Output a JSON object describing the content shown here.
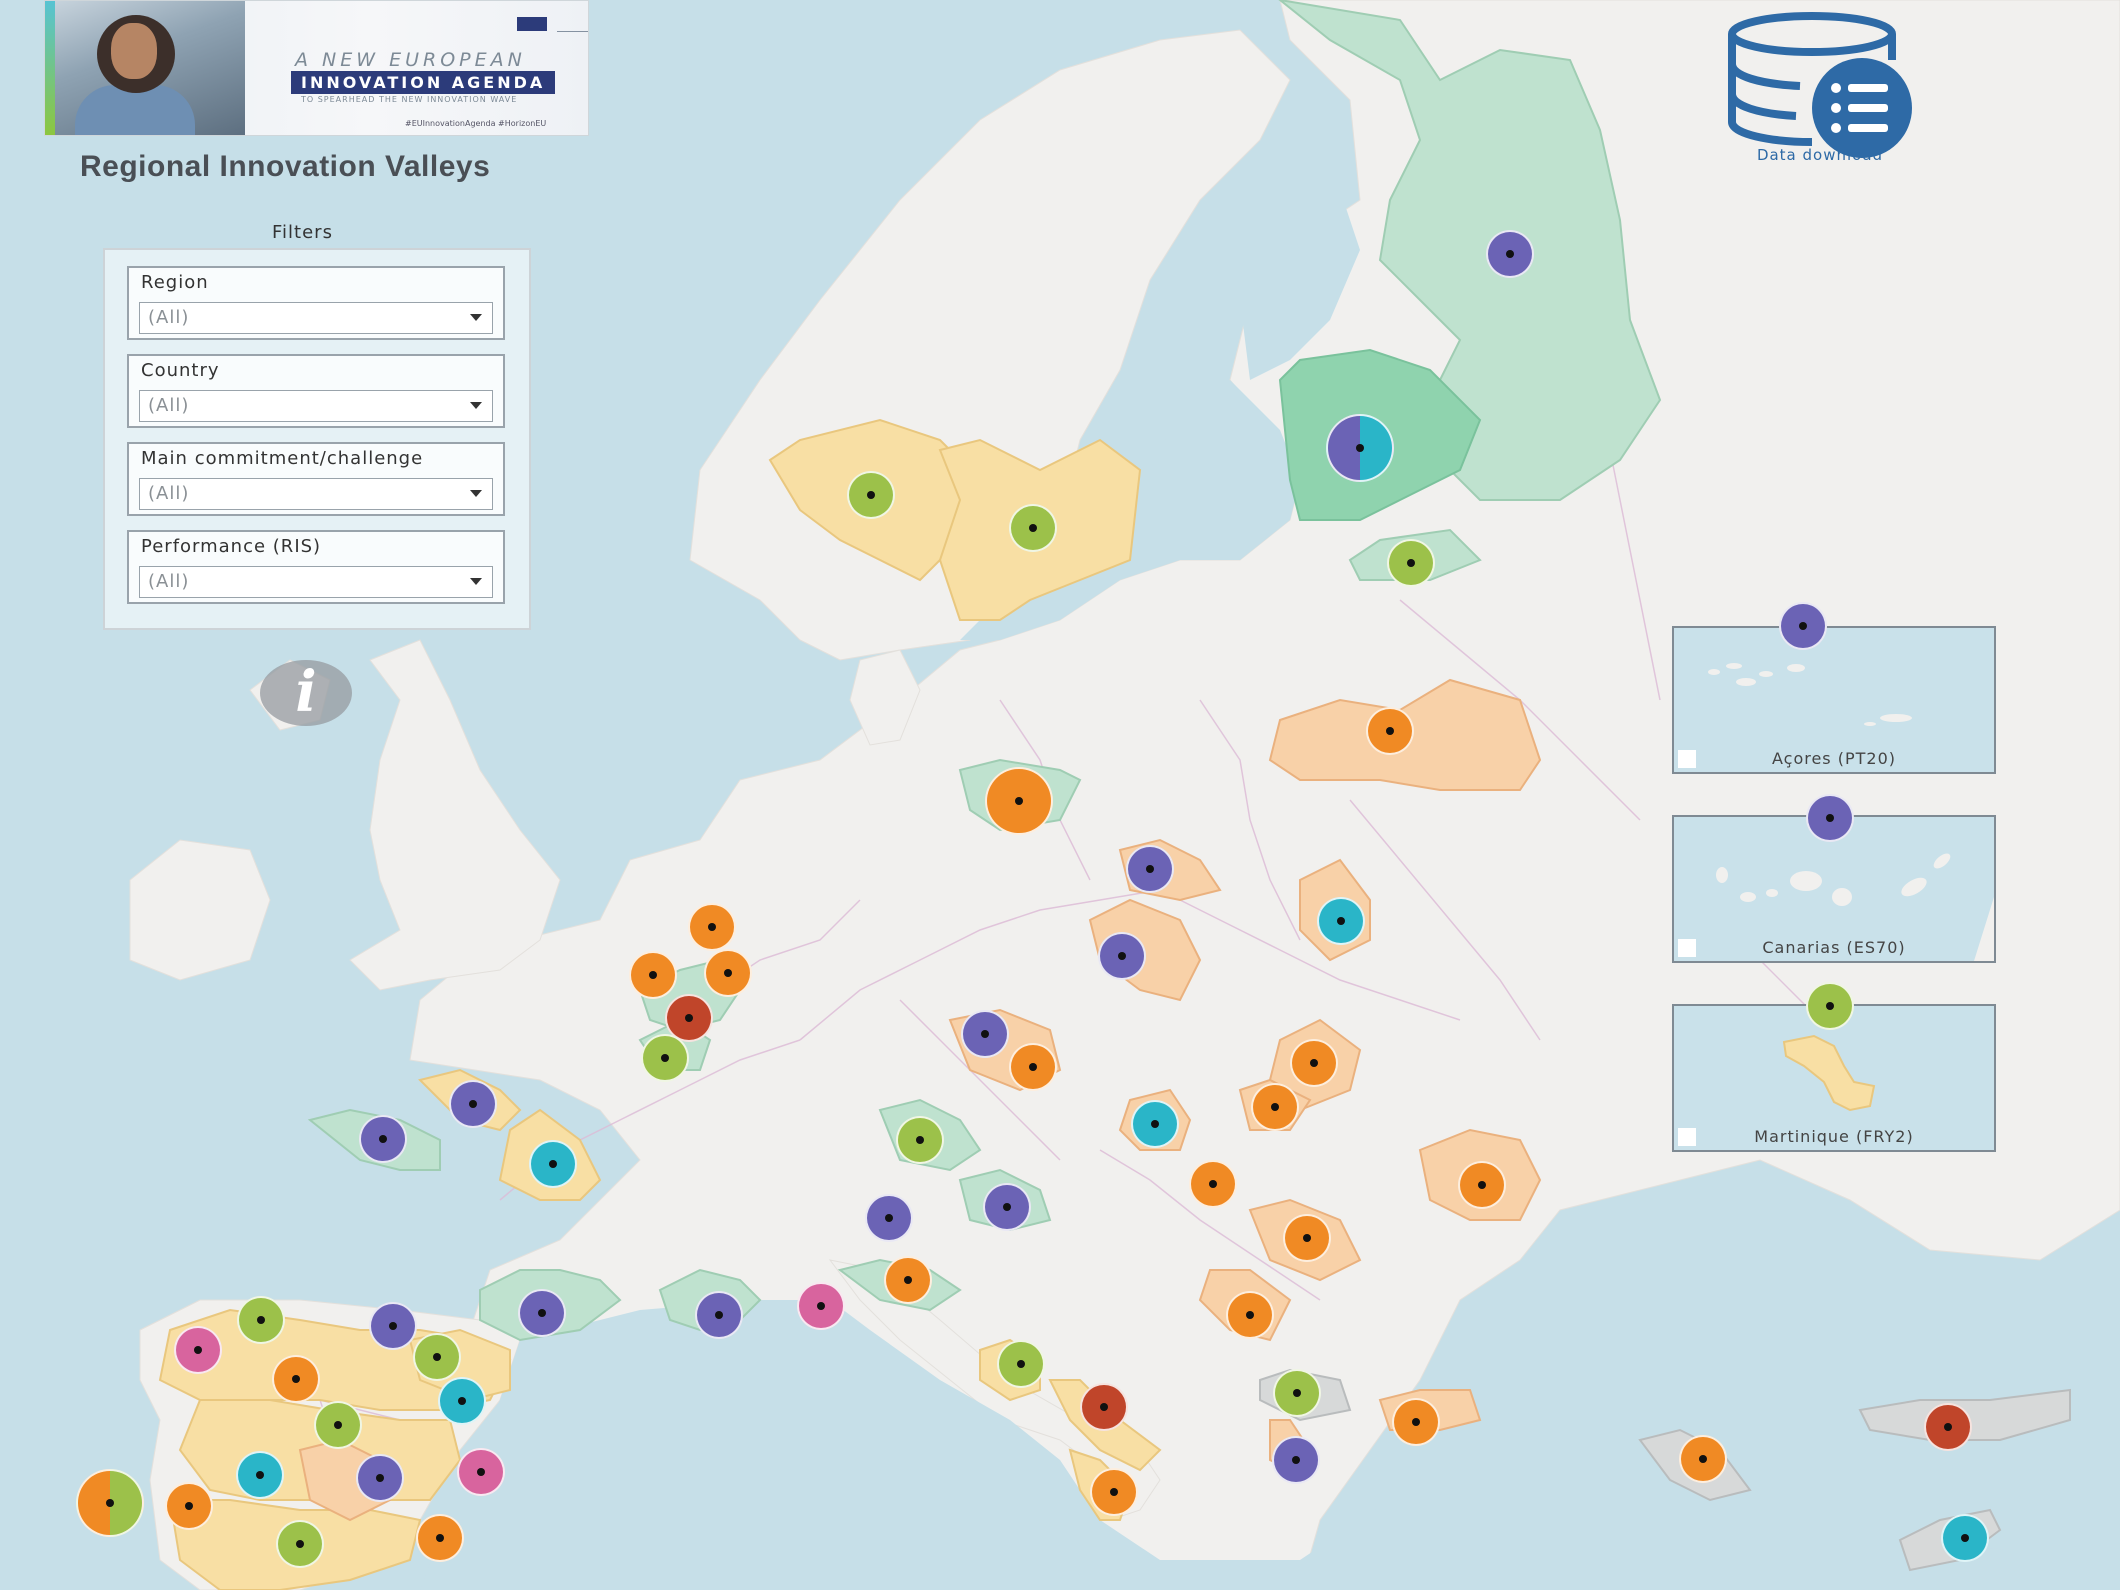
{
  "banner": {
    "line1": "A NEW EUROPEAN",
    "line2": "INNOVATION AGENDA",
    "line3": "TO SPEARHEAD THE NEW INNOVATION WAVE",
    "hashtags": "#EUInnovationAgenda   #HorizonEU"
  },
  "app_title": "Regional Innovation Valleys",
  "filters": {
    "title": "Filters",
    "items": [
      {
        "label": "Region",
        "value": "(All)"
      },
      {
        "label": "Country",
        "value": "(All)"
      },
      {
        "label": "Main commitment/challenge",
        "value": "(All)"
      },
      {
        "label": "Performance (RIS)",
        "value": "(All)"
      }
    ]
  },
  "info_icon": "info-icon",
  "data_download": {
    "label": "Data download",
    "icon": "database-list-icon"
  },
  "colors": {
    "sea": "#c6dfe8",
    "land": "#f1f0ee",
    "border_line": "#d9b8d4",
    "green_region": "#bfe2cf",
    "yellow_region": "#f8dfa4",
    "orange_region": "#f8d1a8",
    "grey_region": "#d7d9d9",
    "marker_purple": "#6b63b5",
    "marker_orange": "#f08a24",
    "marker_green": "#9cc14a",
    "marker_teal": "#2ab5c8",
    "marker_red": "#c0452a",
    "marker_pink": "#d8649e"
  },
  "insets": [
    {
      "label": "Açores (PT20)",
      "marker": "purple"
    },
    {
      "label": "Canarias (ES70)",
      "marker": "purple"
    },
    {
      "label": "Martinique (FRY2)",
      "marker": "green"
    }
  ]
}
